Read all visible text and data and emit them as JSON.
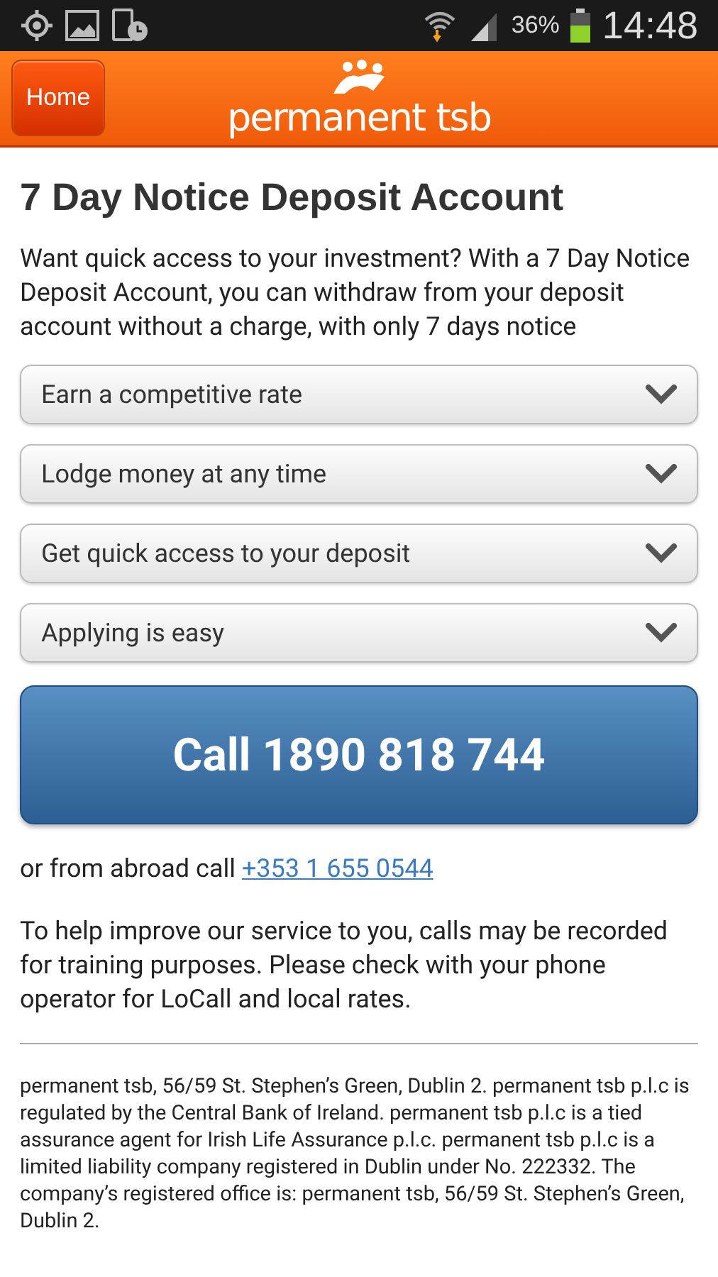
{
  "status_bar": {
    "battery": "36%",
    "time": "14:48"
  },
  "header": {
    "home_button": "Home",
    "logo": "permanent tsb"
  },
  "title": "7 Day Notice Deposit Account",
  "intro": "Want quick access to your investment? With a 7 Day Notice Deposit Account, you can withdraw from your deposit account without a charge, with only 7 days notice",
  "accordion": [
    {
      "label": "Earn a competitive rate",
      "expanded": false
    },
    {
      "label": "Lodge money at any time",
      "expanded": false
    },
    {
      "label": "Get quick access to your deposit",
      "expanded": false
    },
    {
      "label": "Applying is easy",
      "expanded": false
    }
  ],
  "call_button": "Call 1890 818 744",
  "abroad": {
    "text": "or from abroad call",
    "link": "+353 1 655 0544"
  },
  "note": "To help improve our service to you, calls may be recorded for training purposes. Please check with your phone operator for LoCall and local rates.",
  "footer": "permanent tsb, 56/59 St. Stephen’s Green, Dublin 2. permanent tsb p.l.c is regulated by the Central Bank of Ireland. permanent tsb p.l.c is a tied assurance agent for Irish Life Assurance p.l.c. permanent tsb p.l.c is a limited liability company registered in Dublin under No. 222332. The company’s registered office is: permanent tsb, 56/59 St. Stephen’s Green, Dublin 2."
}
